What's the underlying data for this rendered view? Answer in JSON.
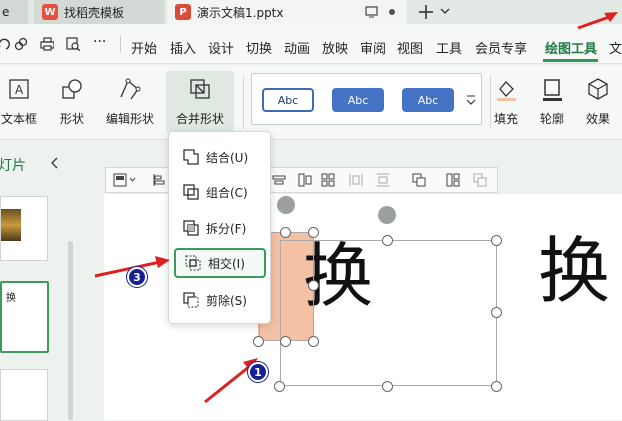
{
  "tabs": [
    {
      "label": "e"
    },
    {
      "label": "找稻壳模板",
      "icon": "wps-icon"
    },
    {
      "label": "演示文稿1.pptx",
      "icon": "ppt-icon"
    }
  ],
  "menu": {
    "items": [
      "开始",
      "插入",
      "设计",
      "切换",
      "动画",
      "放映",
      "审阅",
      "视图",
      "工具",
      "会员专享",
      "绘图工具",
      "文"
    ],
    "active": "绘图工具",
    "more": "···"
  },
  "ribbon": {
    "textbox": "文本框",
    "shape": "形状",
    "edit_shape": "编辑形状",
    "merge_shape": "合并形状",
    "styles": [
      "Abc",
      "Abc",
      "Abc"
    ],
    "fill": "填充",
    "outline": "轮廓",
    "effect": "效果"
  },
  "left_panel": {
    "title": "灯片",
    "thumb_text": "换"
  },
  "dropdown": {
    "items": [
      "结合(U)",
      "组合(C)",
      "拆分(F)",
      "相交(I)",
      "剪除(S)"
    ],
    "highlighted": "相交(I)"
  },
  "slide": {
    "text_main": "换",
    "text_right": "换"
  },
  "badges": [
    "1",
    "3"
  ],
  "colors": {
    "accent_green": "#3c9a5f",
    "shape_fill": "#f4c1a4",
    "arrow_red": "#e02020",
    "badge_blue": "#16208f"
  }
}
